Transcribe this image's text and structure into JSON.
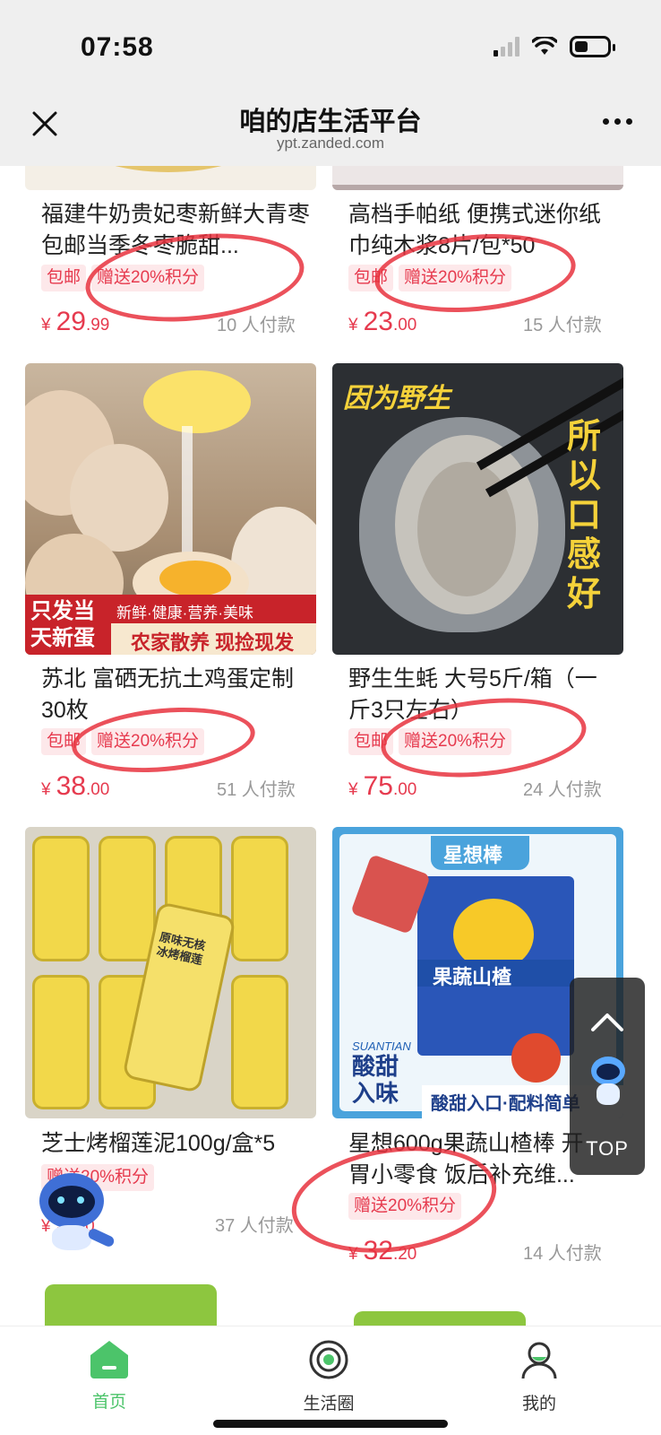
{
  "status": {
    "time": "07:58"
  },
  "nav": {
    "title": "咱的店生活平台",
    "subtitle": "ypt.zanded.com"
  },
  "products": [
    {
      "name": "福建牛奶贵妃枣新鲜大青枣包邮当季冬枣脆甜...",
      "tags": [
        "包邮",
        "赠送20%积分"
      ],
      "price_int": "29",
      "price_dec": ".99",
      "paid": "10 人付款"
    },
    {
      "name": "高档手帕纸 便携式迷你纸巾纯木浆8片/包*50",
      "tags": [
        "包邮",
        "赠送20%积分"
      ],
      "price_int": "23",
      "price_dec": ".00",
      "paid": "15 人付款"
    },
    {
      "name": "苏北 富硒无抗土鸡蛋定制30枚",
      "tags": [
        "包邮",
        "赠送20%积分"
      ],
      "price_int": "38",
      "price_dec": ".00",
      "paid": "51 人付款",
      "image_text": {
        "badge1": "只发当",
        "badge2": "天新蛋",
        "slogan": "新鲜·健康·营养·美味",
        "banner": "农家散养 现捡现发"
      }
    },
    {
      "name": "野生生蚝 大号5斤/箱（一斤3只左右）",
      "tags": [
        "包邮",
        "赠送20%积分"
      ],
      "price_int": "75",
      "price_dec": ".00",
      "paid": "24 人付款",
      "image_text": {
        "top": "因为野生",
        "side": "所以口感好"
      }
    },
    {
      "name": "芝士烤榴莲泥100g/盒*5",
      "tags": [
        "赠送20%积分"
      ],
      "price_int": "5",
      "price_dec": ".00",
      "paid": "37 人付款",
      "image_text": {
        "label": "原味无核冰烤榴莲"
      }
    },
    {
      "name": "星想600g果蔬山楂棒 开胃小零食 饭后补充维...",
      "tags": [
        "赠送20%积分"
      ],
      "price_int": "32",
      "price_dec": ".20",
      "paid": "14 人付款",
      "image_text": {
        "brand": "星想棒",
        "product": "果蔬山楂",
        "taste1": "酸甜",
        "taste2": "入味",
        "footer": "酸甜入口·配料简单",
        "en": "SUANTIAN"
      }
    }
  ],
  "currency": "¥",
  "float": {
    "top_label": "TOP"
  },
  "tabs": [
    {
      "label": "首页"
    },
    {
      "label": "生活圈"
    },
    {
      "label": "我的"
    }
  ],
  "colors": {
    "accent": "#e63a4e",
    "tab_green": "#4cc46a"
  }
}
